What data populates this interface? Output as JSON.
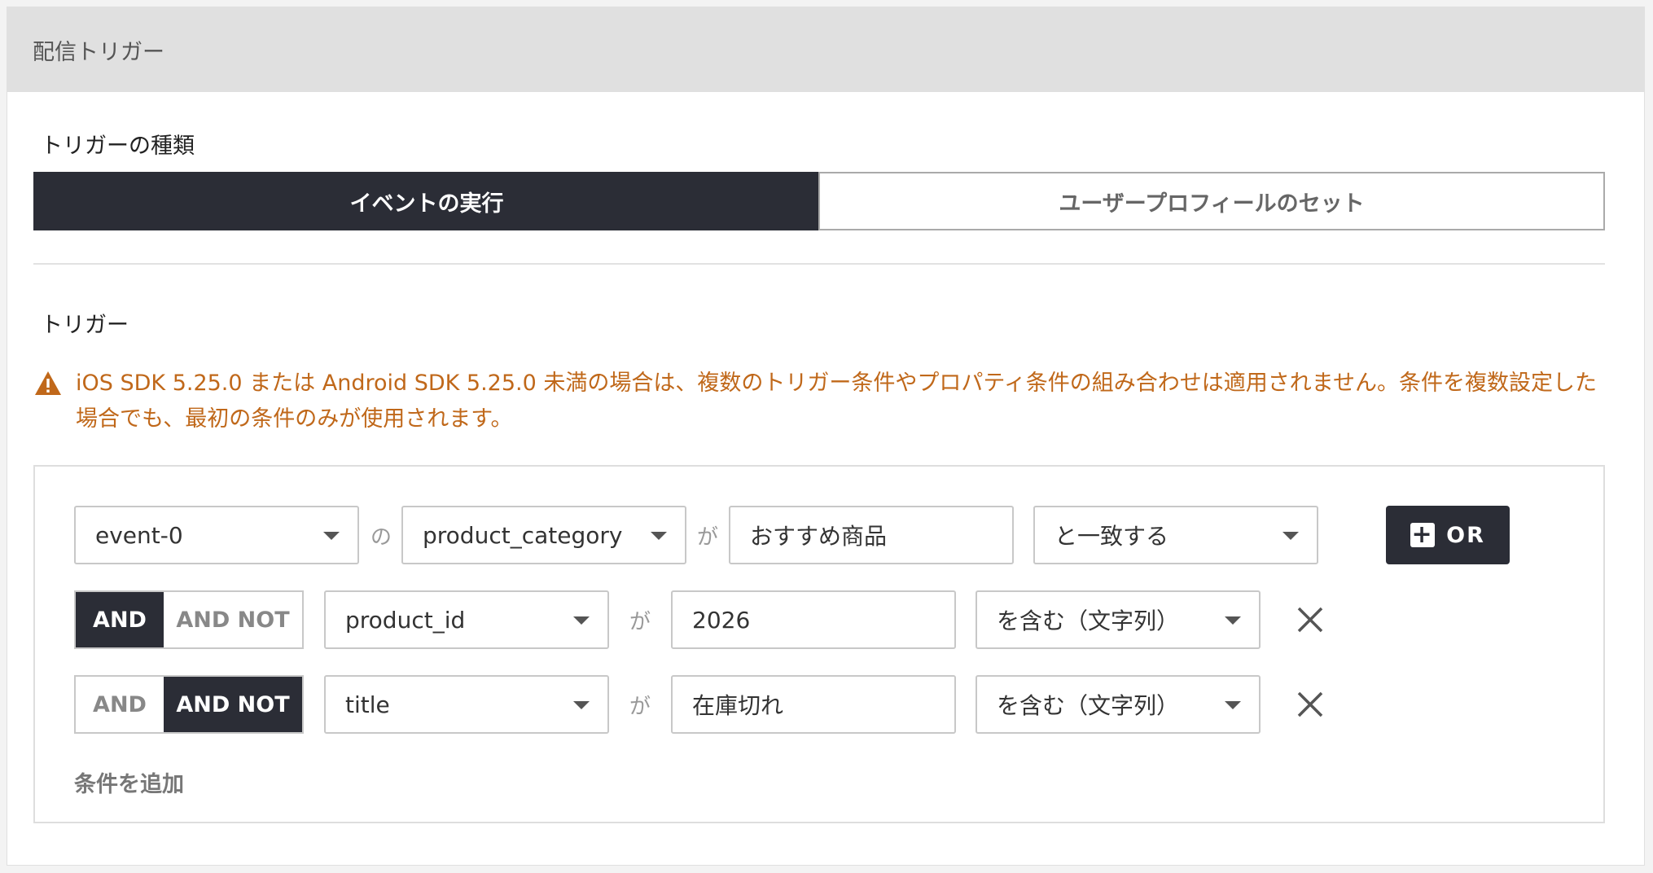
{
  "header": {
    "title": "配信トリガー"
  },
  "trigger_type": {
    "label": "トリガーの種類",
    "options": [
      "イベントの実行",
      "ユーザープロフィールのセット"
    ],
    "selected": "イベントの実行"
  },
  "trigger": {
    "label": "トリガー",
    "warning": "iOS SDK 5.25.0 または Android SDK 5.25.0 未満の場合は、複数のトリガー条件やプロパティ条件の組み合わせは適用されません。条件を複数設定した場合でも、最初の条件のみが使用されます。",
    "first_row": {
      "event": "event-0",
      "connector1": "の",
      "property": "product_category",
      "connector2": "が",
      "value": "おすすめ商品",
      "operator": "と一致する",
      "or_label": "OR"
    },
    "conditions": [
      {
        "logic": "AND",
        "and_label": "AND",
        "and_not_label": "AND NOT",
        "property": "product_id",
        "connector": "が",
        "value": "2026",
        "operator": "を含む（文字列）"
      },
      {
        "logic": "AND NOT",
        "and_label": "AND",
        "and_not_label": "AND NOT",
        "property": "title",
        "connector": "が",
        "value": "在庫切れ",
        "operator": "を含む（文字列）"
      }
    ],
    "add_condition": "条件を追加"
  },
  "colors": {
    "primary_dark": "#2b2d36",
    "warning": "#c0681a",
    "header_bg": "#e0e0e0"
  }
}
